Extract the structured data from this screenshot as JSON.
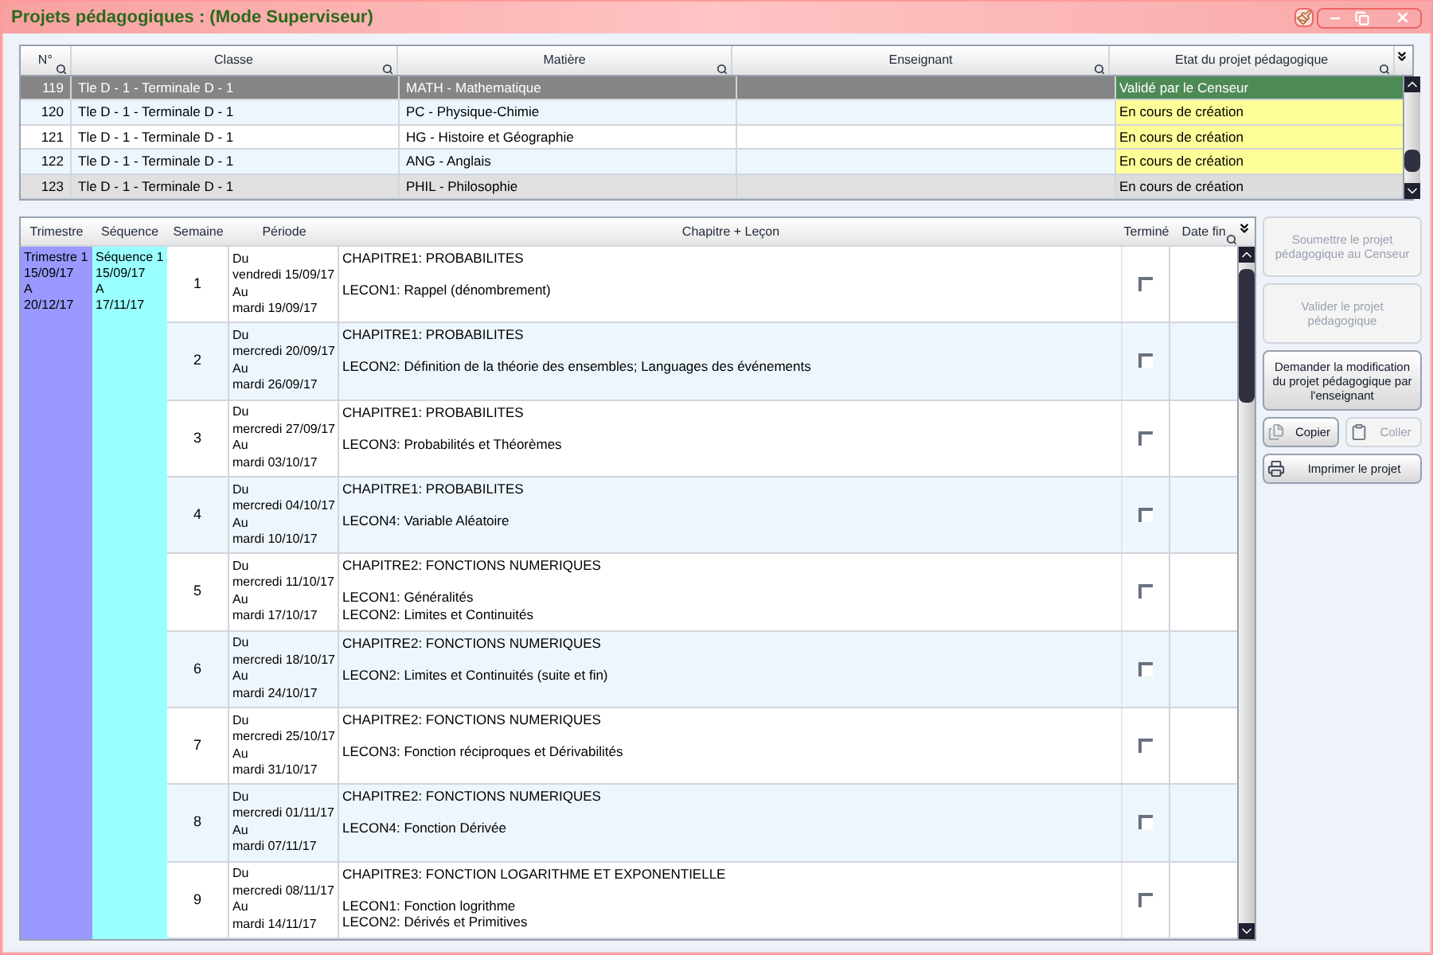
{
  "window": {
    "title": "Projets pédagogiques : (Mode Superviseur)"
  },
  "projects": {
    "columns": [
      "N°",
      "Classe",
      "Matière",
      "Enseignant",
      "Etat du projet pédagogique"
    ],
    "rows": [
      {
        "number": "119",
        "class": "Tle D - 1 - Terminale D - 1",
        "subject": "MATH - Mathematique",
        "status": "Validé par le Censeur",
        "color": "#4e8a56",
        "selected": true,
        "focused": false
      },
      {
        "number": "120",
        "class": "Tle D - 1 - Terminale D - 1",
        "subject": "PC - Physique-Chimie",
        "status": "En cours de création",
        "color": "#ffff99",
        "selected": false,
        "focused": false
      },
      {
        "number": "121",
        "class": "Tle D - 1 - Terminale D - 1",
        "subject": "HG - Histoire et Géographie",
        "status": "En cours de création",
        "color": "#ffff99",
        "selected": false,
        "focused": false
      },
      {
        "number": "122",
        "class": "Tle D - 1 - Terminale D - 1",
        "subject": "ANG - Anglais",
        "status": "En cours de création",
        "color": "#ffff99",
        "selected": false,
        "focused": false
      },
      {
        "number": "123",
        "class": "Tle D - 1 - Terminale D - 1",
        "subject": "PHIL - Philosophie",
        "status": "En cours de création",
        "color": "#dcdcdc",
        "selected": false,
        "focused": true
      }
    ]
  },
  "plan": {
    "columns": [
      "Trimestre",
      "Séquence",
      "Semaine",
      "Période",
      "Chapitre + Leçon",
      "Terminé",
      "Date fin"
    ],
    "term": [
      "Trimestre 1",
      "15/09/17",
      "A",
      "20/12/17"
    ],
    "sequence": [
      "Séquence 1",
      "15/09/17",
      "A",
      "17/11/17"
    ],
    "rows": [
      {
        "week": "1",
        "period": [
          "Du",
          "vendredi 15/09/17",
          "Au",
          "mardi 19/09/17"
        ],
        "chapter": "CHAPITRE1: PROBABILITES",
        "lessons": [
          "LECON1: Rappel (dénombrement)"
        ],
        "done": false
      },
      {
        "week": "2",
        "period": [
          "Du",
          "mercredi 20/09/17",
          "Au",
          "mardi 26/09/17"
        ],
        "chapter": "CHAPITRE1: PROBABILITES",
        "lessons": [
          "LECON2: Définition de la théorie des ensembles; Languages des événements"
        ],
        "done": false
      },
      {
        "week": "3",
        "period": [
          "Du",
          "mercredi 27/09/17",
          "Au",
          "mardi 03/10/17"
        ],
        "chapter": "CHAPITRE1: PROBABILITES",
        "lessons": [
          "LECON3: Probabilités et Théorèmes"
        ],
        "done": false
      },
      {
        "week": "4",
        "period": [
          "Du",
          "mercredi 04/10/17",
          "Au",
          "mardi 10/10/17"
        ],
        "chapter": "CHAPITRE1: PROBABILITES",
        "lessons": [
          "LECON4: Variable Aléatoire"
        ],
        "done": false
      },
      {
        "week": "5",
        "period": [
          "Du",
          "mercredi 11/10/17",
          "Au",
          "mardi 17/10/17"
        ],
        "chapter": "CHAPITRE2: FONCTIONS NUMERIQUES",
        "lessons": [
          "LECON1: Généralités",
          "LECON2: Limites et Continuités"
        ],
        "done": false
      },
      {
        "week": "6",
        "period": [
          "Du",
          "mercredi 18/10/17",
          "Au",
          "mardi 24/10/17"
        ],
        "chapter": "CHAPITRE2: FONCTIONS NUMERIQUES",
        "lessons": [
          "LECON2: Limites et Continuités (suite et fin)"
        ],
        "done": false
      },
      {
        "week": "7",
        "period": [
          "Du",
          "mercredi 25/10/17",
          "Au",
          "mardi 31/10/17"
        ],
        "chapter": "CHAPITRE2: FONCTIONS NUMERIQUES",
        "lessons": [
          "LECON3: Fonction réciproques et Dérivabilités"
        ],
        "done": false
      },
      {
        "week": "8",
        "period": [
          "Du",
          "mercredi 01/11/17",
          "Au",
          "mardi 07/11/17"
        ],
        "chapter": "CHAPITRE2: FONCTIONS NUMERIQUES",
        "lessons": [
          "LECON4: Fonction Dérivée"
        ],
        "done": false
      },
      {
        "week": "9",
        "period": [
          "Du",
          "mercredi 08/11/17",
          "Au",
          "mardi 14/11/17"
        ],
        "chapter": "CHAPITRE3: FONCTION LOGARITHME ET EXPONENTIELLE",
        "lessons": [
          "LECON1: Fonction logrithme",
          "LECON2: Dérivés et Primitives"
        ],
        "done": false
      }
    ]
  },
  "actions": [
    {
      "kind": "text",
      "label": "Soumettre le projet pédagogique au Censeur",
      "disabled": true
    },
    {
      "kind": "text",
      "label": "Valider le projet pédagogique",
      "disabled": true
    },
    {
      "kind": "text",
      "label": "Demander la modification du projet pédagogique par l'enseignant",
      "disabled": false
    },
    {
      "kind": "copy",
      "label": "Copier",
      "disabled": false
    },
    {
      "kind": "paste",
      "label": "Coller",
      "disabled": true
    },
    {
      "kind": "print",
      "label": "Imprimer le projet",
      "disabled": false
    }
  ]
}
